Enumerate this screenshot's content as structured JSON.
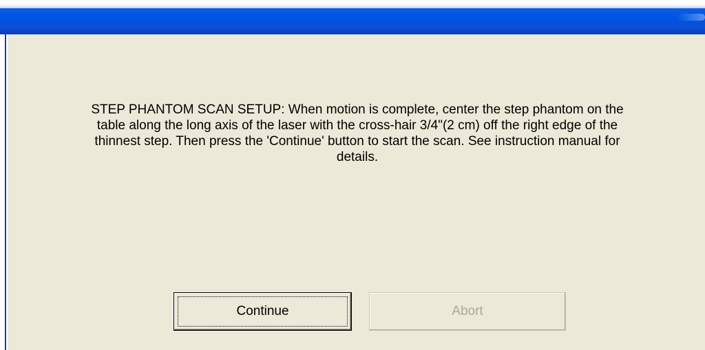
{
  "dialog": {
    "message": "STEP PHANTOM SCAN SETUP:  When motion is complete, center the step phantom on the table along the long axis of the laser with the cross-hair 3/4\"(2 cm) off the right edge of the thinnest step.  Then press the 'Continue' button to start the scan.  See instruction manual for details."
  },
  "buttons": {
    "continue_label": "Continue",
    "abort_label": "Abort",
    "abort_enabled": false
  },
  "colors": {
    "titlebar": "#0054e3",
    "dialog_background": "#ece9d8",
    "disabled_text": "#aca899"
  }
}
